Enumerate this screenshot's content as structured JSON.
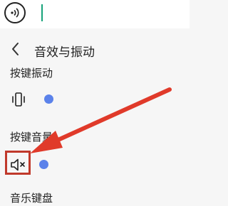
{
  "header": {
    "title": "音效与振动"
  },
  "sections": {
    "vibration": {
      "label": "按键振动",
      "level": 0
    },
    "volume": {
      "label": "按键音量",
      "level": 0
    },
    "music_keyboard": {
      "label": "音乐键盘"
    }
  },
  "icons": {
    "voice": "voice-input-icon",
    "back": "back-arrow-icon",
    "vibration": "vibration-icon",
    "mute": "volume-mute-icon"
  },
  "colors": {
    "accent": "#5b82ea",
    "caret": "#17a37a",
    "annotation": "#e03a2a",
    "highlight_box": "#c0392b"
  }
}
